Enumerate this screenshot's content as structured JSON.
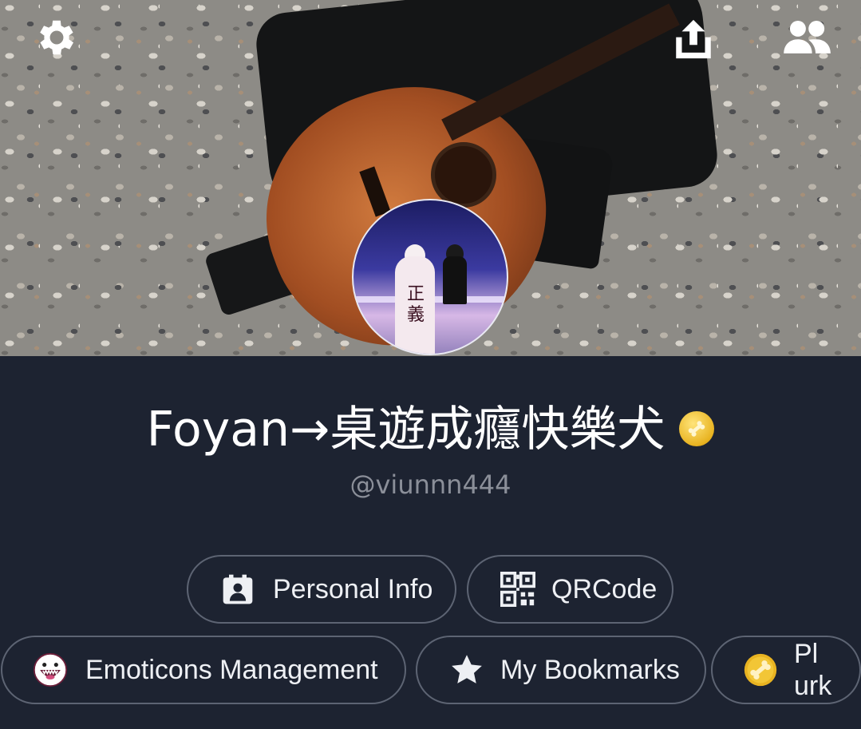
{
  "cover": {
    "settings_icon": "gear-icon",
    "share_icon": "upload-share-icon",
    "friends_icon": "people-icon",
    "avatar_text": "正 義"
  },
  "profile": {
    "display_name": "Foyan→桌遊成癮快樂犬",
    "badge_icon": "bone-coin-icon",
    "handle": "@viunnn444"
  },
  "actions": [
    {
      "label": "Personal Info",
      "icon": "id-card-icon"
    },
    {
      "label": "QRCode",
      "icon": "qrcode-icon"
    },
    {
      "label": "Emoticons Management",
      "icon": "emoticon-face-icon"
    },
    {
      "label": "My Bookmarks",
      "icon": "star-icon"
    },
    {
      "label": "Pl\nurk",
      "icon": "bone-coin-icon"
    }
  ],
  "colors": {
    "background": "#1d2331",
    "pill_border": "#5d6473",
    "handle_text": "#8b8f99",
    "badge_gold": "#e8b321"
  }
}
